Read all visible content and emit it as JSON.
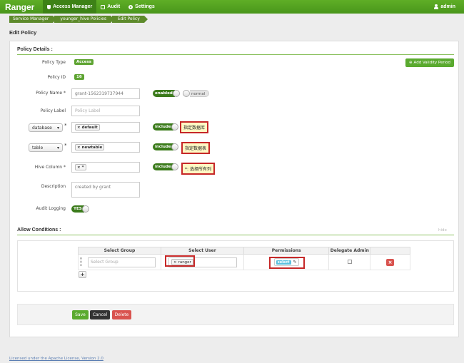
{
  "navbar": {
    "brand": "Ranger",
    "items": [
      {
        "label": "Access Manager",
        "icon": "shield-icon"
      },
      {
        "label": "Audit",
        "icon": "document-icon"
      },
      {
        "label": "Settings",
        "icon": "gear-icon"
      }
    ],
    "user": "admin"
  },
  "breadcrumb": [
    "Service Manager",
    "younger_hive Policies",
    "Edit Policy"
  ],
  "page_title": "Edit Policy",
  "policy_details": {
    "title": "Policy Details :",
    "add_validity_label": "Add Validity Period",
    "policy_type_label": "Policy Type",
    "policy_type_value": "Access",
    "policy_id_label": "Policy ID",
    "policy_id_value": "16",
    "policy_name_label": "Policy Name *",
    "policy_name_value": "grant-1562319737944",
    "enabled_label": "enabled",
    "normal_label": "normal",
    "policy_label_label": "Policy Label",
    "policy_label_placeholder": "Policy Label",
    "resources": [
      {
        "type": "database",
        "value": "default",
        "include": "include",
        "annotation": "指定数据库"
      },
      {
        "type": "table",
        "value": "newtable",
        "include": "include",
        "annotation": "指定数据表"
      }
    ],
    "hive_column_label": "Hive Column *",
    "hive_column_value": "*",
    "hive_column_include": "include",
    "hive_column_annotation": "选择所有列",
    "hive_column_annotation_prefix": "*:",
    "description_label": "Description",
    "description_value": "created by grant",
    "audit_logging_label": "Audit Logging",
    "audit_logging_value": "YES"
  },
  "allow_conditions": {
    "title": "Allow Conditions :",
    "hide_label": "hide",
    "headers": [
      "Select Group",
      "Select User",
      "Permissions",
      "Delegate Admin"
    ],
    "group_placeholder": "Select Group",
    "user_value": "ranger",
    "permission_value": "select",
    "add_label": "+"
  },
  "actions": {
    "save": "Save",
    "cancel": "Cancel",
    "delete": "Delete"
  },
  "footer": "Licensed under the Apache License, Version 2.0",
  "colors": {
    "brand_green": "#5aaa2f",
    "annotation_border": "#c62828",
    "delete_red": "#d9534f"
  }
}
